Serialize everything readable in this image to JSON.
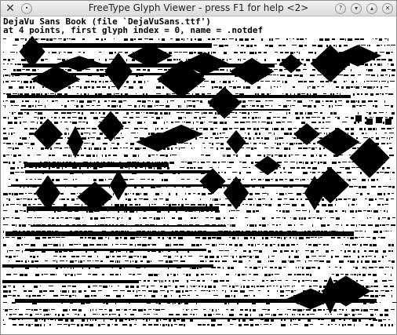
{
  "window": {
    "title": "FreeType Glyph Viewer - press F1 for help <2>",
    "app_icon": "x-icon",
    "buttons": {
      "left": [
        "menu-dot-icon"
      ],
      "right": [
        "help-icon",
        "minimize-icon",
        "maximize-icon",
        "close-icon"
      ]
    }
  },
  "viewer": {
    "font_line": "DejaVu Sans Book (file `DejaVuSans.ttf')",
    "info_line": "at 4 points, first glyph index = 0, name = .notdef"
  },
  "colors": {
    "glyph_ink": "#000000",
    "background": "#ffffff",
    "titlebar": "#dcdcdc"
  }
}
